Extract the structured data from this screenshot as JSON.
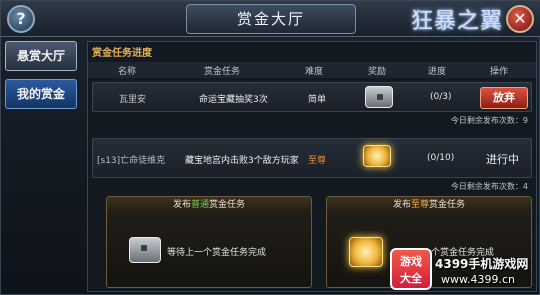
{
  "header": {
    "title": "赏金大厅",
    "logo_text": "狂暴之翼",
    "help_glyph": "?",
    "close_glyph": "✕"
  },
  "sidebar": {
    "items": [
      {
        "label": "悬赏大厅",
        "active": true
      },
      {
        "label": "我的赏金",
        "active": false
      }
    ]
  },
  "progress": {
    "section_title": "赏金任务进度",
    "columns": [
      "名称",
      "赏金任务",
      "难度",
      "奖励",
      "进度",
      "操作"
    ],
    "rows": [
      {
        "name": "瓦里安",
        "task": "命运宝藏抽奖3次",
        "difficulty": "简单",
        "reward_icon": "silver-chest-icon",
        "progress": "(0/3)",
        "action": "放弃",
        "remaining": "今日剩余发布次数：9"
      },
      {
        "name": "[s13]亡命徒维克",
        "task": "藏宝地宫内击败3个敌方玩家",
        "difficulty": "至尊",
        "reward_icon": "gold-chest-icon",
        "progress": "(0/10)",
        "action": "进行中",
        "remaining": "今日剩余发布次数：4"
      }
    ]
  },
  "publish": [
    {
      "prefix": "发布",
      "highlight": "普通",
      "suffix": "赏金任务",
      "status": "等待上一个赏金任务完成",
      "accent": "#6fd13a"
    },
    {
      "prefix": "发布",
      "highlight": "至尊",
      "suffix": "赏金任务",
      "status": "个赏金任务完成",
      "accent": "#ffb23a"
    }
  ],
  "watermark": {
    "badge_line1": "游戏",
    "badge_line2": "大全",
    "site": "4399手机游戏网",
    "url": "www.4399.cn"
  },
  "colors": {
    "gold_text": "#e2b15a",
    "difficulty_easy": "#e6e6e6",
    "difficulty_supreme": "#ff8a2a",
    "button_red": "#c23a25"
  }
}
